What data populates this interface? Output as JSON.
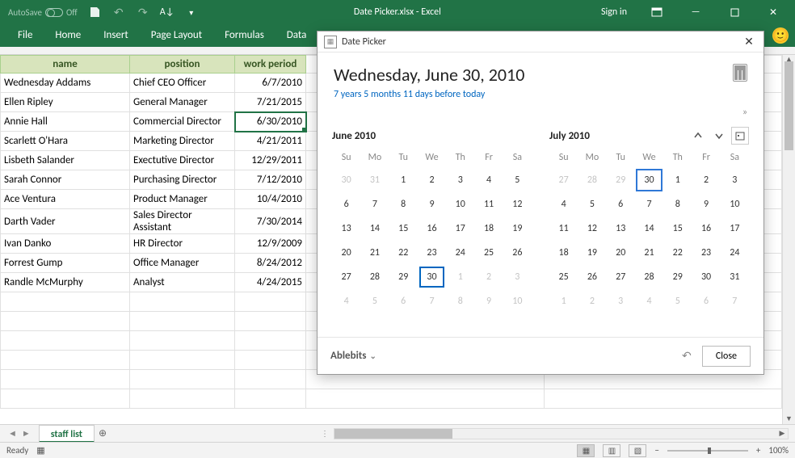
{
  "titlebar": {
    "autosave_label": "AutoSave",
    "autosave_state": "Off",
    "document_title": "Date Picker.xlsx  -  Excel",
    "signin": "Sign in"
  },
  "ribbon": {
    "tabs": [
      "File",
      "Home",
      "Insert",
      "Page Layout",
      "Formulas",
      "Data"
    ]
  },
  "headers": [
    "name",
    "position",
    "work period"
  ],
  "rows": [
    {
      "name": "Wednesday Addams",
      "position": "Chief CEO Officer",
      "period": "6/7/2010"
    },
    {
      "name": "Ellen Ripley",
      "position": "General Manager",
      "period": "7/21/2015"
    },
    {
      "name": "Annie Hall",
      "position": "Commercial Director",
      "period": "6/30/2010",
      "selected": true
    },
    {
      "name": "Scarlett O'Hara",
      "position": "Marketing Director",
      "period": "4/21/2011"
    },
    {
      "name": "Lisbeth Salander",
      "position": "Exectutive Director",
      "period": "12/29/2011"
    },
    {
      "name": "Sarah Connor",
      "position": "Purchasing Director",
      "period": "7/12/2010"
    },
    {
      "name": "Ace Ventura",
      "position": "Product Manager",
      "period": "10/4/2010"
    },
    {
      "name": "Darth Vader",
      "position": "Sales Director Assistant",
      "period": "7/30/2014"
    },
    {
      "name": "Ivan Danko",
      "position": "HR Director",
      "period": "12/9/2009"
    },
    {
      "name": "Forrest Gump",
      "position": "Office Manager",
      "period": "8/24/2012"
    },
    {
      "name": "Randle McMurphy",
      "position": "Analyst",
      "period": "4/24/2015"
    }
  ],
  "sheet_tab": "staff list",
  "statusbar": {
    "ready": "Ready",
    "zoom": "100%"
  },
  "picker": {
    "title": "Date Picker",
    "selected_date_long": "Wednesday, June 30, 2010",
    "diff_text": "7 years 5 months 11 days before today",
    "brand": "Ablebits",
    "close_label": "Close",
    "dow": [
      "Su",
      "Mo",
      "Tu",
      "We",
      "Th",
      "Fr",
      "Sa"
    ],
    "month_left": {
      "label": "June 2010",
      "weeks": [
        [
          {
            "d": 30,
            "o": true
          },
          {
            "d": 31,
            "o": true
          },
          {
            "d": 1
          },
          {
            "d": 2
          },
          {
            "d": 3
          },
          {
            "d": 4
          },
          {
            "d": 5
          }
        ],
        [
          {
            "d": 6
          },
          {
            "d": 7
          },
          {
            "d": 8
          },
          {
            "d": 9
          },
          {
            "d": 10
          },
          {
            "d": 11
          },
          {
            "d": 12
          }
        ],
        [
          {
            "d": 13
          },
          {
            "d": 14
          },
          {
            "d": 15
          },
          {
            "d": 16
          },
          {
            "d": 17
          },
          {
            "d": 18
          },
          {
            "d": 19
          }
        ],
        [
          {
            "d": 20
          },
          {
            "d": 21
          },
          {
            "d": 22
          },
          {
            "d": 23
          },
          {
            "d": 24
          },
          {
            "d": 25
          },
          {
            "d": 26
          }
        ],
        [
          {
            "d": 27
          },
          {
            "d": 28
          },
          {
            "d": 29
          },
          {
            "d": 30,
            "sel": true
          },
          {
            "d": 1,
            "o": true
          },
          {
            "d": 2,
            "o": true
          },
          {
            "d": 3,
            "o": true
          }
        ],
        [
          {
            "d": 4,
            "o": true
          },
          {
            "d": 5,
            "o": true
          },
          {
            "d": 6,
            "o": true
          },
          {
            "d": 7,
            "o": true
          },
          {
            "d": 8,
            "o": true
          },
          {
            "d": 9,
            "o": true
          },
          {
            "d": 10,
            "o": true
          }
        ]
      ]
    },
    "month_right": {
      "label": "July 2010",
      "weeks": [
        [
          {
            "d": 27,
            "o": true
          },
          {
            "d": 28,
            "o": true
          },
          {
            "d": 29,
            "o": true
          },
          {
            "d": 30,
            "today": true
          },
          {
            "d": 1
          },
          {
            "d": 2
          },
          {
            "d": 3
          }
        ],
        [
          {
            "d": 4
          },
          {
            "d": 5
          },
          {
            "d": 6
          },
          {
            "d": 7
          },
          {
            "d": 8
          },
          {
            "d": 9
          },
          {
            "d": 10
          }
        ],
        [
          {
            "d": 11
          },
          {
            "d": 12
          },
          {
            "d": 13
          },
          {
            "d": 14
          },
          {
            "d": 15
          },
          {
            "d": 16
          },
          {
            "d": 17
          }
        ],
        [
          {
            "d": 18
          },
          {
            "d": 19
          },
          {
            "d": 20
          },
          {
            "d": 21
          },
          {
            "d": 22
          },
          {
            "d": 23
          },
          {
            "d": 24
          }
        ],
        [
          {
            "d": 25
          },
          {
            "d": 26
          },
          {
            "d": 27
          },
          {
            "d": 28
          },
          {
            "d": 29
          },
          {
            "d": 30
          },
          {
            "d": 31
          }
        ],
        [
          {
            "d": 1,
            "o": true
          },
          {
            "d": 2,
            "o": true
          },
          {
            "d": 3,
            "o": true
          },
          {
            "d": 4,
            "o": true
          },
          {
            "d": 5,
            "o": true
          },
          {
            "d": 6,
            "o": true
          },
          {
            "d": 7,
            "o": true
          }
        ]
      ]
    }
  }
}
